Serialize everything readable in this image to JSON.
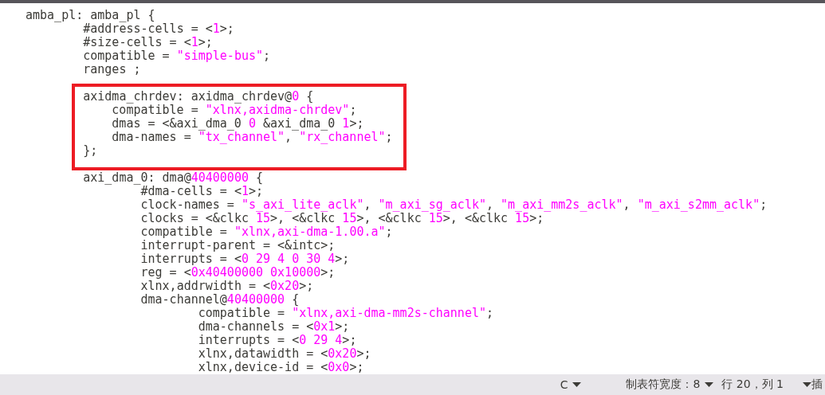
{
  "editor": {
    "lines": [
      {
        "segments": [
          {
            "t": "amba_pl: amba_pl {",
            "kind": "plain"
          }
        ],
        "children": [
          {
            "segments": [
              {
                "t": "#address-cells = <",
                "kind": "plain"
              },
              {
                "t": "1",
                "kind": "literal"
              },
              {
                "t": ">;",
                "kind": "plain"
              }
            ]
          },
          {
            "segments": [
              {
                "t": "#size-cells = <",
                "kind": "plain"
              },
              {
                "t": "1",
                "kind": "literal"
              },
              {
                "t": ">;",
                "kind": "plain"
              }
            ]
          },
          {
            "segments": [
              {
                "t": "compatible = ",
                "kind": "plain"
              },
              {
                "t": "\"simple-bus\"",
                "kind": "literal"
              },
              {
                "t": ";",
                "kind": "plain"
              }
            ]
          },
          {
            "segments": [
              {
                "t": "ranges ;",
                "kind": "plain"
              }
            ]
          },
          {
            "kind": "highlight",
            "children": [
              {
                "segments": [
                  {
                    "t": "axidma_chrdev: axidma_chrdev@",
                    "kind": "plain"
                  },
                  {
                    "t": "0",
                    "kind": "literal"
                  },
                  {
                    "t": " {",
                    "kind": "plain"
                  }
                ],
                "children": [
                  {
                    "segments": [
                      {
                        "t": "compatible = ",
                        "kind": "plain"
                      },
                      {
                        "t": "\"xlnx,axidma-chrdev\"",
                        "kind": "literal"
                      },
                      {
                        "t": ";",
                        "kind": "plain"
                      }
                    ]
                  },
                  {
                    "segments": [
                      {
                        "t": "dmas = <&axi_dma_0 ",
                        "kind": "plain"
                      },
                      {
                        "t": "0",
                        "kind": "literal"
                      },
                      {
                        "t": " &axi_dma_0 ",
                        "kind": "plain"
                      },
                      {
                        "t": "1",
                        "kind": "literal"
                      },
                      {
                        "t": ">;",
                        "kind": "plain"
                      }
                    ]
                  },
                  {
                    "segments": [
                      {
                        "t": "dma-names = ",
                        "kind": "plain"
                      },
                      {
                        "t": "\"tx_channel\"",
                        "kind": "literal"
                      },
                      {
                        "t": ", ",
                        "kind": "plain"
                      },
                      {
                        "t": "\"rx_channel\"",
                        "kind": "literal"
                      },
                      {
                        "t": ";",
                        "kind": "plain"
                      }
                    ]
                  }
                ]
              },
              {
                "segments": [
                  {
                    "t": "};",
                    "kind": "plain"
                  }
                ]
              }
            ]
          },
          {
            "segments": [
              {
                "t": "axi_dma_0: dma@",
                "kind": "plain"
              },
              {
                "t": "40400000",
                "kind": "literal"
              },
              {
                "t": " {",
                "kind": "plain"
              }
            ],
            "children": [
              {
                "segments": [
                  {
                    "t": "#dma-cells = <",
                    "kind": "plain"
                  },
                  {
                    "t": "1",
                    "kind": "literal"
                  },
                  {
                    "t": ">;",
                    "kind": "plain"
                  }
                ]
              },
              {
                "segments": [
                  {
                    "t": "clock-names = ",
                    "kind": "plain"
                  },
                  {
                    "t": "\"s_axi_lite_aclk\"",
                    "kind": "literal"
                  },
                  {
                    "t": ", ",
                    "kind": "plain"
                  },
                  {
                    "t": "\"m_axi_sg_aclk\"",
                    "kind": "literal"
                  },
                  {
                    "t": ", ",
                    "kind": "plain"
                  },
                  {
                    "t": "\"m_axi_mm2s_aclk\"",
                    "kind": "literal"
                  },
                  {
                    "t": ", ",
                    "kind": "plain"
                  },
                  {
                    "t": "\"m_axi_s2mm_aclk\"",
                    "kind": "literal"
                  },
                  {
                    "t": ";",
                    "kind": "plain"
                  }
                ]
              },
              {
                "segments": [
                  {
                    "t": "clocks = <&clkc ",
                    "kind": "plain"
                  },
                  {
                    "t": "15",
                    "kind": "literal"
                  },
                  {
                    "t": ">, <&clkc ",
                    "kind": "plain"
                  },
                  {
                    "t": "15",
                    "kind": "literal"
                  },
                  {
                    "t": ">, <&clkc ",
                    "kind": "plain"
                  },
                  {
                    "t": "15",
                    "kind": "literal"
                  },
                  {
                    "t": ">, <&clkc ",
                    "kind": "plain"
                  },
                  {
                    "t": "15",
                    "kind": "literal"
                  },
                  {
                    "t": ">;",
                    "kind": "plain"
                  }
                ]
              },
              {
                "segments": [
                  {
                    "t": "compatible = ",
                    "kind": "plain"
                  },
                  {
                    "t": "\"xlnx,axi-dma-1.00.a\"",
                    "kind": "literal"
                  },
                  {
                    "t": ";",
                    "kind": "plain"
                  }
                ]
              },
              {
                "segments": [
                  {
                    "t": "interrupt-parent = <&intc>;",
                    "kind": "plain"
                  }
                ]
              },
              {
                "segments": [
                  {
                    "t": "interrupts = <",
                    "kind": "plain"
                  },
                  {
                    "t": "0 29 4 0 30 4",
                    "kind": "literal"
                  },
                  {
                    "t": ">;",
                    "kind": "plain"
                  }
                ]
              },
              {
                "segments": [
                  {
                    "t": "reg = <",
                    "kind": "plain"
                  },
                  {
                    "t": "0x40400000 0x10000",
                    "kind": "literal"
                  },
                  {
                    "t": ">;",
                    "kind": "plain"
                  }
                ]
              },
              {
                "segments": [
                  {
                    "t": "xlnx,addrwidth = <",
                    "kind": "plain"
                  },
                  {
                    "t": "0x20",
                    "kind": "literal"
                  },
                  {
                    "t": ">;",
                    "kind": "plain"
                  }
                ]
              },
              {
                "segments": [
                  {
                    "t": "dma-channel@",
                    "kind": "plain"
                  },
                  {
                    "t": "40400000",
                    "kind": "literal"
                  },
                  {
                    "t": " {",
                    "kind": "plain"
                  }
                ],
                "children": [
                  {
                    "segments": [
                      {
                        "t": "compatible = ",
                        "kind": "plain"
                      },
                      {
                        "t": "\"xlnx,axi-dma-mm2s-channel\"",
                        "kind": "literal"
                      },
                      {
                        "t": ";",
                        "kind": "plain"
                      }
                    ]
                  },
                  {
                    "segments": [
                      {
                        "t": "dma-channels = <",
                        "kind": "plain"
                      },
                      {
                        "t": "0x1",
                        "kind": "literal"
                      },
                      {
                        "t": ">;",
                        "kind": "plain"
                      }
                    ]
                  },
                  {
                    "segments": [
                      {
                        "t": "interrupts = <",
                        "kind": "plain"
                      },
                      {
                        "t": "0 29 4",
                        "kind": "literal"
                      },
                      {
                        "t": ">;",
                        "kind": "plain"
                      }
                    ]
                  },
                  {
                    "segments": [
                      {
                        "t": "xlnx,datawidth = <",
                        "kind": "plain"
                      },
                      {
                        "t": "0x20",
                        "kind": "literal"
                      },
                      {
                        "t": ">;",
                        "kind": "plain"
                      }
                    ]
                  },
                  {
                    "segments": [
                      {
                        "t": "xlnx,device-id = <",
                        "kind": "plain"
                      },
                      {
                        "t": "0x0",
                        "kind": "literal"
                      },
                      {
                        "t": ">;",
                        "kind": "plain"
                      }
                    ]
                  }
                ]
              }
            ]
          }
        ]
      }
    ]
  },
  "status_bar": [
    {
      "kind": "dropdown",
      "label": "C"
    },
    {
      "kind": "dropdown",
      "label": "制表符宽度：8"
    },
    {
      "kind": "text",
      "label": "行 20，列 1"
    },
    {
      "kind": "dropdown"
    },
    {
      "kind": "text",
      "label": "插"
    }
  ]
}
